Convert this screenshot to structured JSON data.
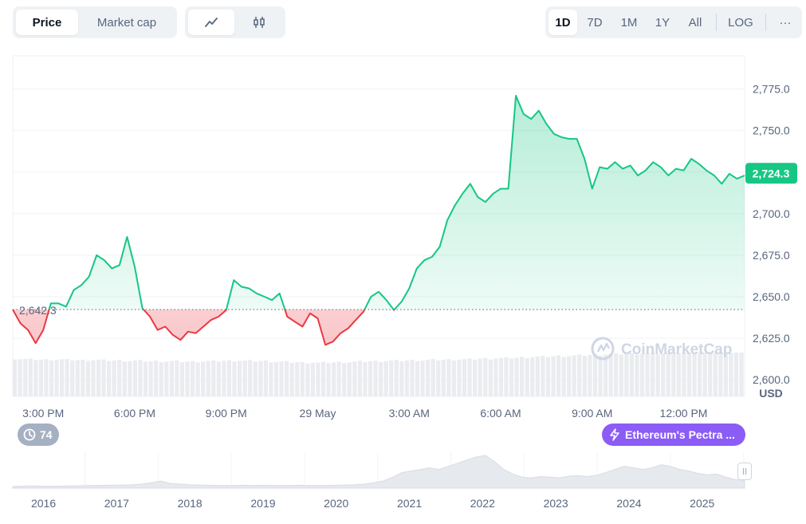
{
  "toolbar": {
    "metric_tabs": [
      "Price",
      "Market cap"
    ],
    "range_tabs": [
      "1D",
      "7D",
      "1M",
      "1Y",
      "All"
    ],
    "log_label": "LOG",
    "more_label": "···"
  },
  "chart_data": {
    "type": "area",
    "currency": "USD",
    "reference_line": 2642.3,
    "current_value": 2724.3,
    "ylim": [
      2590,
      2795
    ],
    "y_ticks": [
      2600,
      2625,
      2650,
      2675,
      2700,
      2725,
      2750,
      2775
    ],
    "y_tick_labels": [
      "2,600.0",
      "2,625.0",
      "2,650.0",
      "2,675.0",
      "2,700.0",
      "2,725.0",
      "2,750.0",
      "2,775.0"
    ],
    "x_tick_labels": [
      "3:00 PM",
      "6:00 PM",
      "9:00 PM",
      "29 May",
      "3:00 AM",
      "6:00 AM",
      "9:00 AM",
      "12:00 PM"
    ],
    "reference_label": "2,642.3",
    "current_label": "2,724.3",
    "colors": {
      "up": "#16c784",
      "down": "#ea3943",
      "accent": "#8b5cf6"
    },
    "x_hours": [
      0,
      0.25,
      0.5,
      0.75,
      1,
      1.25,
      1.5,
      1.75,
      2,
      2.25,
      2.5,
      2.75,
      3,
      3.25,
      3.5,
      3.75,
      4,
      4.25,
      4.5,
      4.75,
      5,
      5.25,
      5.5,
      5.75,
      6,
      6.25,
      6.5,
      6.75,
      7,
      7.25,
      7.5,
      7.75,
      8,
      8.25,
      8.5,
      8.75,
      9,
      9.25,
      9.5,
      9.75,
      10,
      10.25,
      10.5,
      10.75,
      11,
      11.25,
      11.5,
      11.75,
      12,
      12.25,
      12.5,
      12.75,
      13,
      13.25,
      13.5,
      13.75,
      14,
      14.25,
      14.5,
      14.75,
      15,
      15.25,
      15.5,
      15.75,
      16,
      16.25,
      16.5,
      16.75,
      17,
      17.25,
      17.5,
      17.75,
      18,
      18.25,
      18.5,
      18.75,
      19,
      19.25,
      19.5,
      19.75,
      20,
      20.25,
      20.5,
      20.75,
      21,
      21.25,
      21.5,
      21.75,
      22,
      22.25,
      22.5,
      22.75,
      23,
      23.25,
      23.5,
      23.75,
      24
    ],
    "values": [
      2642.3,
      2634,
      2630,
      2622,
      2630,
      2646,
      2646,
      2644,
      2654,
      2657,
      2662,
      2675,
      2672,
      2667,
      2669,
      2686,
      2668,
      2643,
      2638,
      2630,
      2632,
      2627,
      2624,
      2629,
      2628,
      2632,
      2636,
      2638,
      2642,
      2660,
      2656,
      2655,
      2652,
      2650,
      2648,
      2652,
      2638,
      2635,
      2632,
      2640,
      2637,
      2621,
      2623,
      2628,
      2631,
      2636,
      2641,
      2650,
      2653,
      2648,
      2642,
      2647,
      2655,
      2667,
      2672,
      2674,
      2680,
      2696,
      2705,
      2712,
      2718,
      2710,
      2707,
      2712,
      2715,
      2715,
      2771,
      2760,
      2757,
      2762,
      2754,
      2748,
      2746,
      2745,
      2745,
      2733,
      2715,
      2728,
      2727,
      2731,
      2727,
      2729,
      2723,
      2726,
      2731,
      2728,
      2723,
      2727,
      2726,
      2733,
      2730,
      2726,
      2723,
      2718,
      2724,
      2721,
      2723,
      2724,
      2724.3
    ],
    "volume_relative": [
      0.86,
      0.85,
      0.84,
      0.84,
      0.83,
      0.84,
      0.84,
      0.83,
      0.83,
      0.82,
      0.83,
      0.83,
      0.82,
      0.82,
      0.82,
      0.81,
      0.81,
      0.81,
      0.8,
      0.8,
      0.8,
      0.8,
      0.8,
      0.79,
      0.79,
      0.8,
      0.8,
      0.8,
      0.81,
      0.81,
      0.82,
      0.81,
      0.81,
      0.81,
      0.8,
      0.79,
      0.79,
      0.78,
      0.78,
      0.77,
      0.77,
      0.76,
      0.77,
      0.77,
      0.78,
      0.78,
      0.79,
      0.79,
      0.8,
      0.8,
      0.81,
      0.81,
      0.81,
      0.82,
      0.82,
      0.82,
      0.83,
      0.83,
      0.83,
      0.84,
      0.84,
      0.84,
      0.85,
      0.86,
      0.86,
      0.87,
      0.87,
      0.88,
      0.88,
      0.89,
      0.9,
      0.9,
      0.91,
      0.92,
      0.92,
      0.93,
      0.93,
      0.94,
      0.95,
      0.95,
      0.96,
      0.96,
      0.97,
      0.97,
      0.97,
      0.98,
      0.98,
      0.98,
      0.98,
      0.99,
      0.99,
      0.99,
      0.99,
      1.0,
      1.0,
      1.0,
      1.0,
      1.0,
      1.0
    ],
    "x_hour_ticks": [
      1,
      4,
      7,
      10,
      13,
      16,
      19,
      22
    ]
  },
  "overview": {
    "years": [
      "2016",
      "2017",
      "2018",
      "2019",
      "2020",
      "2021",
      "2022",
      "2023",
      "2024",
      "2025"
    ],
    "relative_price": [
      0.0,
      0.01,
      0.02,
      0.01,
      0.01,
      0.01,
      0.02,
      0.02,
      0.03,
      0.03,
      0.04,
      0.04,
      0.05,
      0.06,
      0.08,
      0.12,
      0.18,
      0.1,
      0.08,
      0.06,
      0.05,
      0.04,
      0.03,
      0.03,
      0.03,
      0.04,
      0.03,
      0.04,
      0.03,
      0.03,
      0.03,
      0.04,
      0.03,
      0.03,
      0.03,
      0.04,
      0.05,
      0.06,
      0.08,
      0.12,
      0.18,
      0.3,
      0.45,
      0.5,
      0.55,
      0.6,
      0.55,
      0.65,
      0.75,
      0.85,
      0.95,
      1.0,
      0.8,
      0.55,
      0.4,
      0.3,
      0.28,
      0.32,
      0.3,
      0.28,
      0.33,
      0.35,
      0.32,
      0.36,
      0.45,
      0.55,
      0.65,
      0.6,
      0.55,
      0.6,
      0.7,
      0.65,
      0.55,
      0.5,
      0.42,
      0.38,
      0.4,
      0.3,
      0.22,
      0.2
    ]
  },
  "watermark": "CoinMarketCap",
  "badges": {
    "history_count": "74",
    "event_label": "Ethereum's Pectra ..."
  }
}
